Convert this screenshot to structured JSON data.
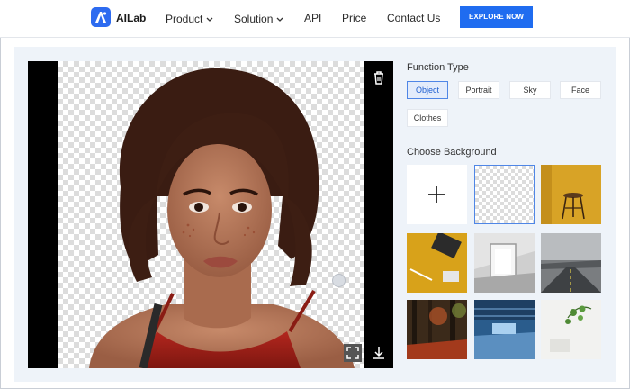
{
  "header": {
    "brand": "AILab",
    "nav": [
      {
        "label": "Product",
        "dropdown": true
      },
      {
        "label": "Solution",
        "dropdown": true
      },
      {
        "label": "API",
        "dropdown": false
      },
      {
        "label": "Price",
        "dropdown": false
      },
      {
        "label": "Contact Us",
        "dropdown": false
      }
    ],
    "cta": "EXPLORE NOW"
  },
  "colors": {
    "accent": "#1f6cf0",
    "panel": "#eef3f9",
    "active_border": "#4f86e6"
  },
  "editor": {
    "icons": [
      "trash-icon",
      "fullscreen-icon",
      "download-icon"
    ]
  },
  "function_type": {
    "title": "Function Type",
    "options": [
      "Object",
      "Portrait",
      "Sky",
      "Face",
      "Clothes"
    ],
    "selected": "Object"
  },
  "background": {
    "title": "Choose Background",
    "tiles": [
      "add",
      "transparent",
      "yellow-stool",
      "yellow-desk",
      "white-frame",
      "road",
      "autumn-forest",
      "blue-hall",
      "plant-shelf"
    ],
    "selected": "transparent"
  }
}
